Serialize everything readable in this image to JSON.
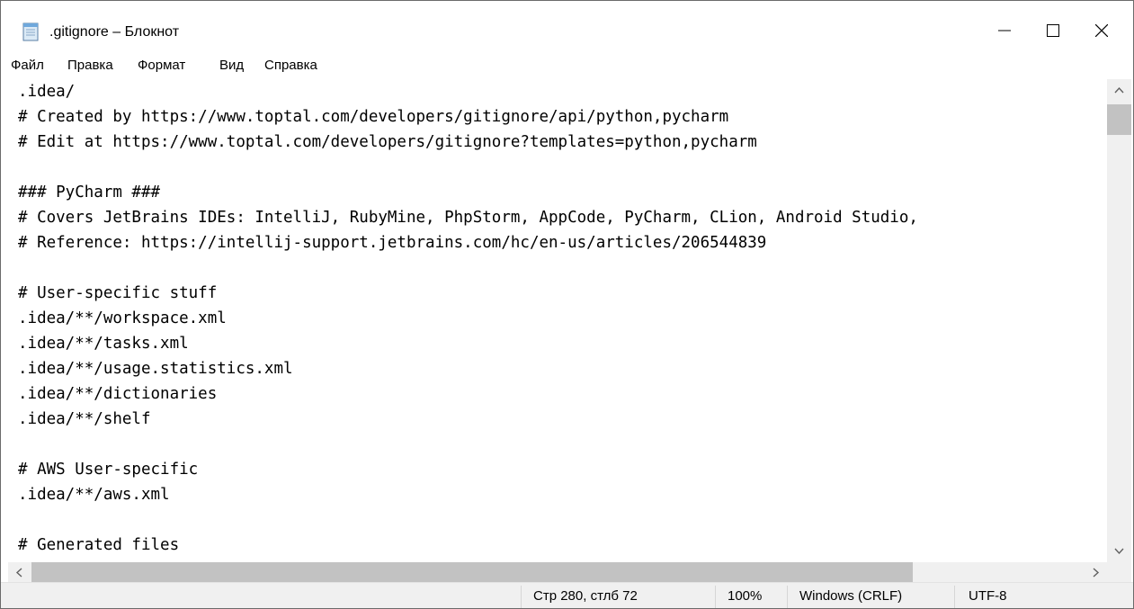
{
  "window": {
    "title": ".gitignore – Блокнот",
    "app_icon": "notepad-icon",
    "controls": [
      "minimize-icon",
      "maximize-icon",
      "close-icon"
    ]
  },
  "menu": {
    "items": [
      "Файл",
      "Правка",
      "Формат",
      "Вид",
      "Справка"
    ]
  },
  "editor": {
    "lines": [
      ".idea/",
      "# Created by https://www.toptal.com/developers/gitignore/api/python,pycharm",
      "# Edit at https://www.toptal.com/developers/gitignore?templates=python,pycharm",
      "",
      "### PyCharm ###",
      "# Covers JetBrains IDEs: IntelliJ, RubyMine, PhpStorm, AppCode, PyCharm, CLion, Android Studio,",
      "# Reference: https://intellij-support.jetbrains.com/hc/en-us/articles/206544839",
      "",
      "# User-specific stuff",
      ".idea/**/workspace.xml",
      ".idea/**/tasks.xml",
      ".idea/**/usage.statistics.xml",
      ".idea/**/dictionaries",
      ".idea/**/shelf",
      "",
      "# AWS User-specific",
      ".idea/**/aws.xml",
      "",
      "# Generated files"
    ]
  },
  "statusbar": {
    "position": "Стр 280, стлб 72",
    "zoom": "100%",
    "line_endings": "Windows (CRLF)",
    "encoding": "UTF-8"
  },
  "colors": {
    "scrollbar_track": "#f0f0f0",
    "scrollbar_thumb": "#c2c2c2",
    "statusbar_bg": "#f0f0f0"
  }
}
